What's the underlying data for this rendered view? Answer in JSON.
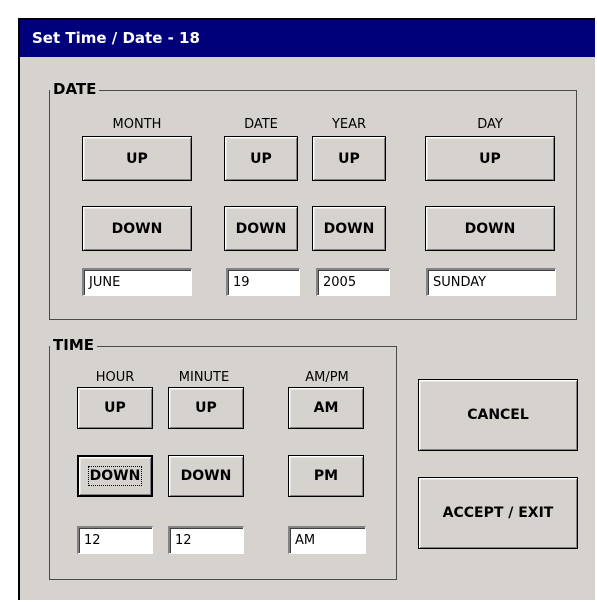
{
  "window": {
    "title": "Set Time / Date - 18"
  },
  "date_group": {
    "label": "DATE",
    "columns": {
      "month": {
        "header": "MONTH",
        "up": "UP",
        "down": "DOWN",
        "value": "JUNE"
      },
      "date": {
        "header": "DATE",
        "up": "UP",
        "down": "DOWN",
        "value": "19"
      },
      "year": {
        "header": "YEAR",
        "up": "UP",
        "down": "DOWN",
        "value": "2005"
      },
      "day": {
        "header": "DAY",
        "up": "UP",
        "down": "DOWN",
        "value": "SUNDAY"
      }
    }
  },
  "time_group": {
    "label": "TIME",
    "columns": {
      "hour": {
        "header": "HOUR",
        "up": "UP",
        "down": "DOWN",
        "value": "12"
      },
      "minute": {
        "header": "MINUTE",
        "up": "UP",
        "down": "DOWN",
        "value": "12"
      },
      "ampm": {
        "header": "AM/PM",
        "am": "AM",
        "pm": "PM",
        "value": "AM"
      }
    }
  },
  "actions": {
    "cancel": "CANCEL",
    "accept": "ACCEPT / EXIT"
  },
  "colors": {
    "titlebar": "#00007b",
    "face": "#d6d3ce"
  }
}
